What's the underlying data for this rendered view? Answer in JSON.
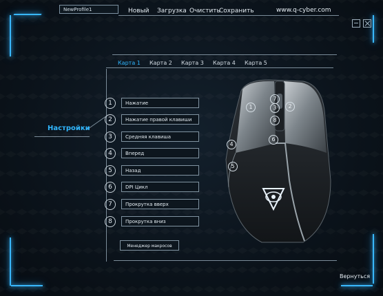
{
  "topbar": {
    "profile": "NewProfile1",
    "menu": [
      "Новый",
      "Загрузка",
      "Очистить",
      "Сохранить"
    ],
    "site": "www.q-cyber.com"
  },
  "tabs": [
    "Карта 1",
    "Карта 2",
    "Карта 3",
    "Карта 4",
    "Карта 5"
  ],
  "sidebar": {
    "label": "Настройки"
  },
  "buttons": [
    {
      "num": "1",
      "label": "Нажатие"
    },
    {
      "num": "2",
      "label": "Нажатие правой клавиши"
    },
    {
      "num": "3",
      "label": "Средняя клавиша"
    },
    {
      "num": "4",
      "label": "Вперед"
    },
    {
      "num": "5",
      "label": "Назад"
    },
    {
      "num": "6",
      "label": "DPI Цикл"
    },
    {
      "num": "7",
      "label": "Прокрутка вверх"
    },
    {
      "num": "8",
      "label": "Прокрутка вниз"
    }
  ],
  "macro_button": "Менеджер макросов",
  "back_button": "Вернуться",
  "mouse_labels": [
    "1",
    "2",
    "3",
    "4",
    "5",
    "6",
    "7",
    "8"
  ],
  "colors": {
    "accent": "#2fb6ff",
    "glow": "#39b8ff"
  }
}
